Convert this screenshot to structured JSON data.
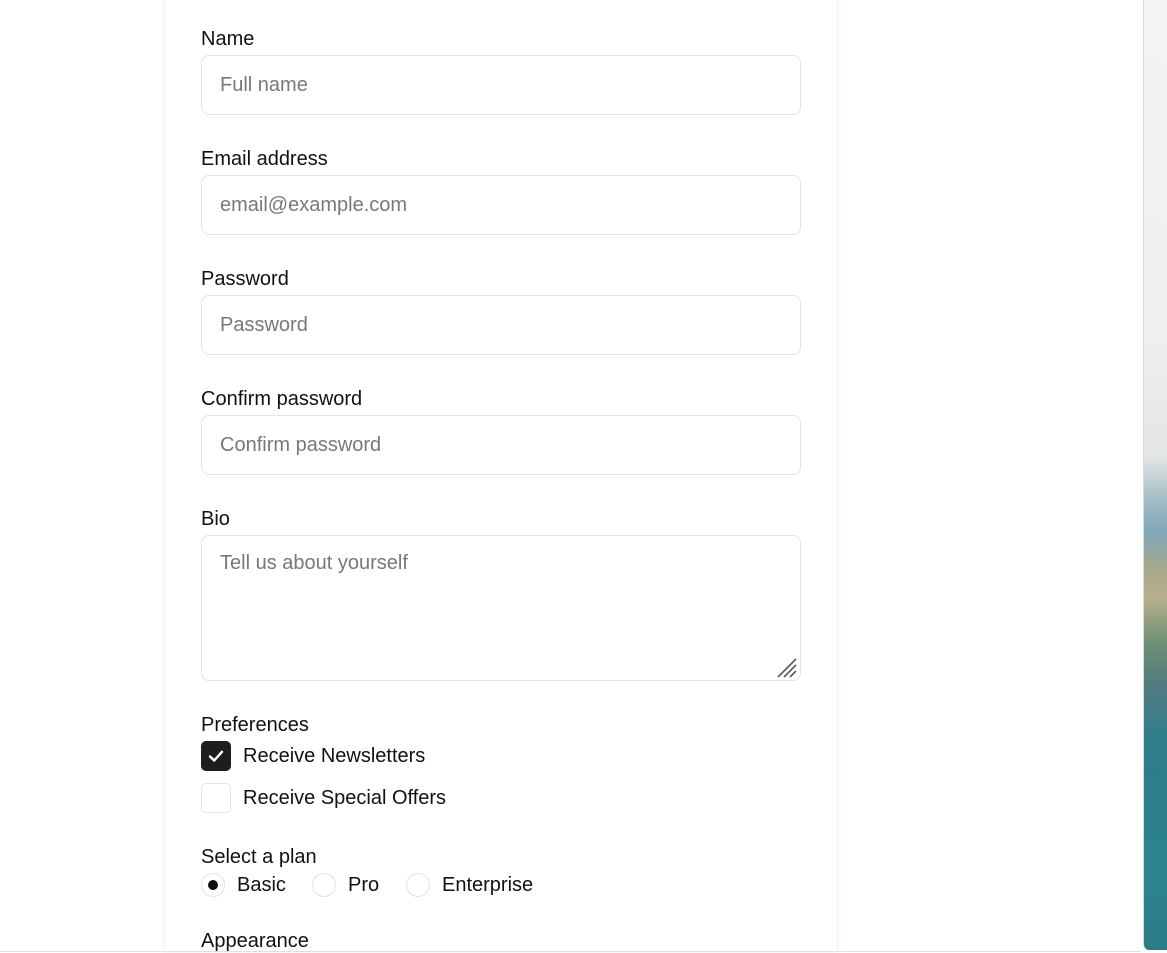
{
  "form": {
    "name": {
      "label": "Name",
      "placeholder": "Full name",
      "value": ""
    },
    "email": {
      "label": "Email address",
      "placeholder": "email@example.com",
      "value": ""
    },
    "password": {
      "label": "Password",
      "placeholder": "Password",
      "value": ""
    },
    "confirm_password": {
      "label": "Confirm password",
      "placeholder": "Confirm password",
      "value": ""
    },
    "bio": {
      "label": "Bio",
      "placeholder": "Tell us about yourself",
      "value": ""
    },
    "preferences": {
      "label": "Preferences",
      "options": [
        {
          "label": "Receive Newsletters",
          "checked": true
        },
        {
          "label": "Receive Special Offers",
          "checked": false
        }
      ]
    },
    "plan": {
      "label": "Select a plan",
      "options": [
        {
          "label": "Basic",
          "selected": true
        },
        {
          "label": "Pro",
          "selected": false
        },
        {
          "label": "Enterprise",
          "selected": false
        }
      ]
    },
    "appearance": {
      "label": "Appearance"
    }
  },
  "icons": {
    "checkmark": "check-icon",
    "resize": "resize-grip-icon"
  },
  "colors": {
    "checkbox_checked": "#1d1d1f",
    "input_border": "#e3e3e3",
    "placeholder": "#77787a"
  }
}
